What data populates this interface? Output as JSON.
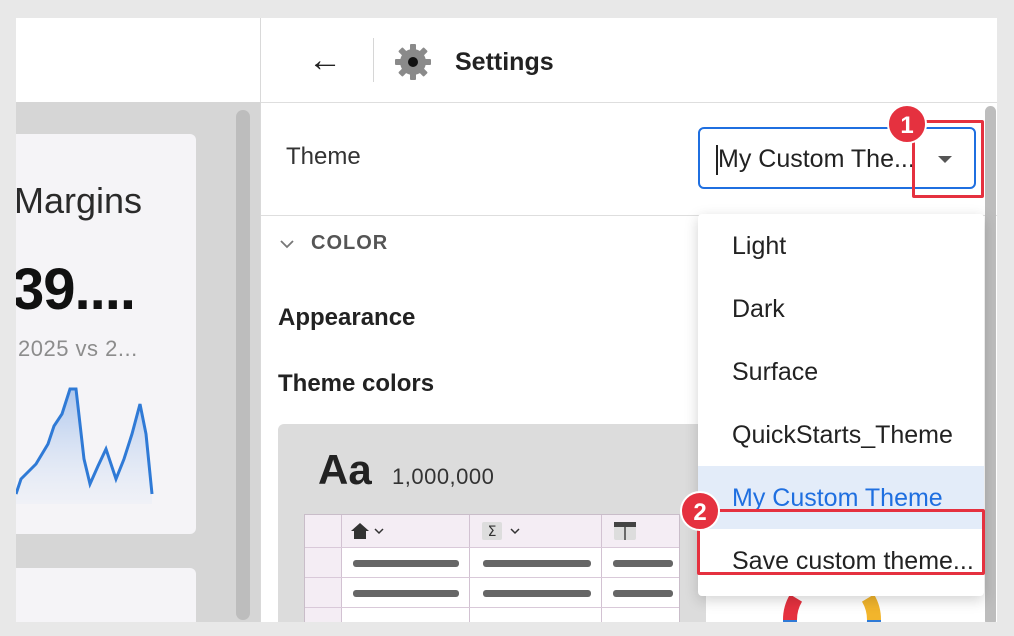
{
  "dashboard": {
    "card_title": "Margins",
    "card_value": "39....",
    "card_subtitle": "2025 vs 2...",
    "sparkline_color": "#2f7ad6"
  },
  "header": {
    "back_icon": "←",
    "title": "Settings"
  },
  "theme": {
    "label": "Theme",
    "selected_value": "My Custom The...",
    "options": [
      {
        "label": "Light",
        "selected": false
      },
      {
        "label": "Dark",
        "selected": false
      },
      {
        "label": "Surface",
        "selected": false
      },
      {
        "label": "QuickStarts_Theme",
        "selected": false
      },
      {
        "label": "My Custom Theme",
        "selected": true
      },
      {
        "label": "Save custom theme...",
        "selected": false
      }
    ]
  },
  "color_section": {
    "title": "COLOR",
    "appearance_label": "Appearance",
    "theme_colors_label": "Theme colors",
    "preview_aa": "Aa",
    "preview_number": "1,000,000"
  },
  "annotations": [
    {
      "number": "1"
    },
    {
      "number": "2"
    }
  ],
  "colors": {
    "accent": "#1f6fe0",
    "callout": "#e5313f"
  }
}
